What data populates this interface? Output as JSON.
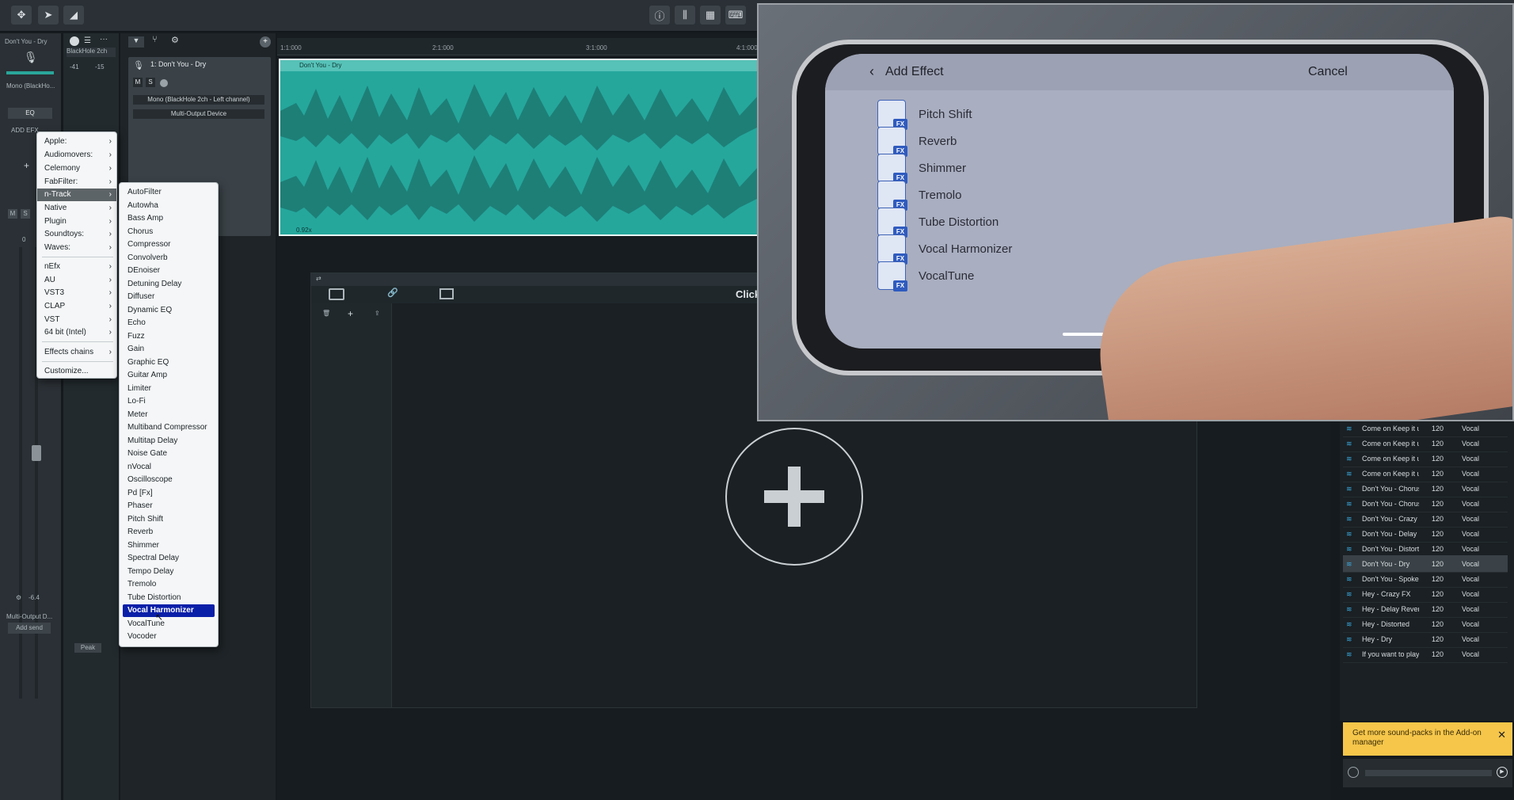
{
  "topbar": {
    "tools": [
      "move-icon",
      "pointer-icon",
      "volume-envelope-icon"
    ],
    "right_tools": [
      "info-icon",
      "mixer-icon",
      "grid-icon",
      "keyboard-icon"
    ]
  },
  "left_strip": {
    "track_name": "Don't You - Dry",
    "input": "Mono (BlackHo...",
    "eq": "EQ",
    "add_fx": "ADD EFX",
    "m": "M",
    "s": "S",
    "level": "0",
    "db": "-6.4",
    "output": "Multi-Output D...",
    "add_send": "Add send"
  },
  "mixer2": {
    "meter_left": "-41",
    "meter_right": "-15",
    "bottom": "Peak",
    "input_label": "BlackHole 2ch"
  },
  "track": {
    "name": "1: Don't You - Dry",
    "m": "M",
    "s": "S",
    "input": "Mono (BlackHole 2ch - Left channel)",
    "output": "Multi-Output Device"
  },
  "ruler": {
    "marks": [
      "1:1:000",
      "2:1:000",
      "3:1:000",
      "4:1:000"
    ]
  },
  "clip": {
    "name": "Don't You - Dry",
    "gain": "0.92x"
  },
  "editor": {
    "click_label": "Click"
  },
  "menu1": {
    "items": [
      {
        "label": "Apple:",
        "sub": true
      },
      {
        "label": "Audiomovers:",
        "sub": true
      },
      {
        "label": "Celemony",
        "sub": true
      },
      {
        "label": "FabFilter:",
        "sub": true
      },
      {
        "label": "n-Track",
        "sub": true
      },
      {
        "label": "Native",
        "sub": true
      },
      {
        "label": "Plugin",
        "sub": true
      },
      {
        "label": "Soundtoys:",
        "sub": true
      },
      {
        "label": "Waves:",
        "sub": true
      },
      {
        "label": "nEfx",
        "sub": true
      },
      {
        "label": "AU",
        "sub": true
      },
      {
        "label": "VST3",
        "sub": true
      },
      {
        "label": "CLAP",
        "sub": true
      },
      {
        "label": "VST",
        "sub": true
      },
      {
        "label": "64 bit (Intel)",
        "sub": true
      },
      {
        "label": "Effects chains",
        "sub": true
      },
      {
        "label": "Customize...",
        "sub": false
      }
    ]
  },
  "menu2": {
    "items": [
      "AutoFilter",
      "Autowha",
      "Bass Amp",
      "Chorus",
      "Compressor",
      "Convolverb",
      "DEnoiser",
      "Detuning Delay",
      "Diffuser",
      "Dynamic EQ",
      "Echo",
      "Fuzz",
      "Gain",
      "Graphic EQ",
      "Guitar Amp",
      "Limiter",
      "Lo-Fi",
      "Meter",
      "Multiband Compressor",
      "Multitap Delay",
      "Noise Gate",
      "nVocal",
      "Oscilloscope",
      "Pd [Fx]",
      "Phaser",
      "Pitch Shift",
      "Reverb",
      "Shimmer",
      "Spectral Delay",
      "Tempo Delay",
      "Tremolo",
      "Tube Distortion",
      "Vocal Harmonizer",
      "VocalTune",
      "Vocoder"
    ],
    "highlighted": "Vocal Harmonizer"
  },
  "library": {
    "rows": [
      {
        "name": "Come on Keep it up...",
        "bpm": "120",
        "type": "Vocal"
      },
      {
        "name": "Come on Keep it up...",
        "bpm": "120",
        "type": "Vocal"
      },
      {
        "name": "Come on Keep it up...",
        "bpm": "120",
        "type": "Vocal"
      },
      {
        "name": "Come on Keep it up...",
        "bpm": "120",
        "type": "Vocal"
      },
      {
        "name": "Don't You - Chorus A",
        "bpm": "120",
        "type": "Vocal"
      },
      {
        "name": "Don't You - Chorus B",
        "bpm": "120",
        "type": "Vocal"
      },
      {
        "name": "Don't You - Crazy FX",
        "bpm": "120",
        "type": "Vocal"
      },
      {
        "name": "Don't You - Delay Rev...",
        "bpm": "120",
        "type": "Vocal"
      },
      {
        "name": "Don't You - Distortion",
        "bpm": "120",
        "type": "Vocal"
      },
      {
        "name": "Don't You - Dry",
        "bpm": "120",
        "type": "Vocal"
      },
      {
        "name": "Don't You - Spoken",
        "bpm": "120",
        "type": "Vocal"
      },
      {
        "name": "Hey - Crazy FX",
        "bpm": "120",
        "type": "Vocal"
      },
      {
        "name": "Hey - Delay Reverb",
        "bpm": "120",
        "type": "Vocal"
      },
      {
        "name": "Hey - Distorted",
        "bpm": "120",
        "type": "Vocal"
      },
      {
        "name": "Hey - Dry",
        "bpm": "120",
        "type": "Vocal"
      },
      {
        "name": "If you want to play -...",
        "bpm": "120",
        "type": "Vocal"
      }
    ],
    "selected_index": 9,
    "promo": "Get more sound-packs in the Add-on manager"
  },
  "phone": {
    "back_label": "Add Effect",
    "cancel_label": "Cancel",
    "fx_badge": "FX",
    "effects": [
      "Pitch Shift",
      "Reverb",
      "Shimmer",
      "Tremolo",
      "Tube Distortion",
      "Vocal Harmonizer",
      "VocalTune"
    ]
  }
}
